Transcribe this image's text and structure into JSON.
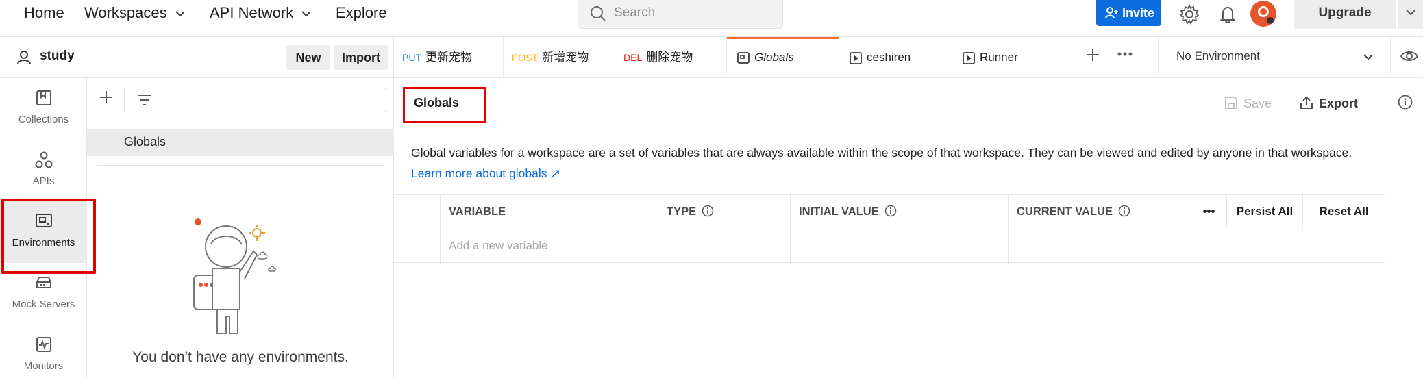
{
  "topbar": {
    "nav": [
      "Home",
      "Workspaces",
      "API Network",
      "Explore"
    ],
    "search_placeholder": "Search",
    "invite_label": "Invite",
    "upgrade_label": "Upgrade",
    "icons": [
      "settings-icon",
      "bell-icon",
      "avatar"
    ]
  },
  "workspace": {
    "name": "study",
    "new_label": "New",
    "import_label": "Import"
  },
  "rail": {
    "items": [
      {
        "label": "Collections",
        "icon": "collections-icon"
      },
      {
        "label": "APIs",
        "icon": "apis-icon"
      },
      {
        "label": "Environments",
        "icon": "environments-icon",
        "active": true
      },
      {
        "label": "Mock Servers",
        "icon": "mock-servers-icon"
      },
      {
        "label": "Monitors",
        "icon": "monitors-icon"
      }
    ]
  },
  "env_panel": {
    "globals_label": "Globals",
    "empty_text": "You don’t have any environments."
  },
  "tabs": [
    {
      "method": "PUT",
      "method_color": "#097bed",
      "label": "更新宠物"
    },
    {
      "method": "POST",
      "method_color": "#ffb400",
      "label": "新增宠物"
    },
    {
      "method": "DEL",
      "method_color": "#eb2013",
      "label": "删除宠物"
    },
    {
      "label": "Globals",
      "active": true
    },
    {
      "label": "ceshiren"
    },
    {
      "label": "Runner"
    }
  ],
  "environment_selector": "No Environment",
  "main": {
    "title": "Globals",
    "save_label": "Save",
    "export_label": "Export",
    "description": "Global variables for a workspace are a set of variables that are always available within the scope of that workspace. They can be viewed and edited by anyone in that workspace.",
    "learn_more": "Learn more about globals ↗",
    "table": {
      "headers": [
        "VARIABLE",
        "TYPE",
        "INITIAL VALUE",
        "CURRENT VALUE"
      ],
      "more": "•••",
      "persist_all": "Persist All",
      "reset_all": "Reset All",
      "add_placeholder": "Add a new variable"
    }
  },
  "colors": {
    "accent": "#ff6c37",
    "invite": "#0b6dde",
    "highlight_box": "#e30000",
    "link": "#0b6dde"
  }
}
